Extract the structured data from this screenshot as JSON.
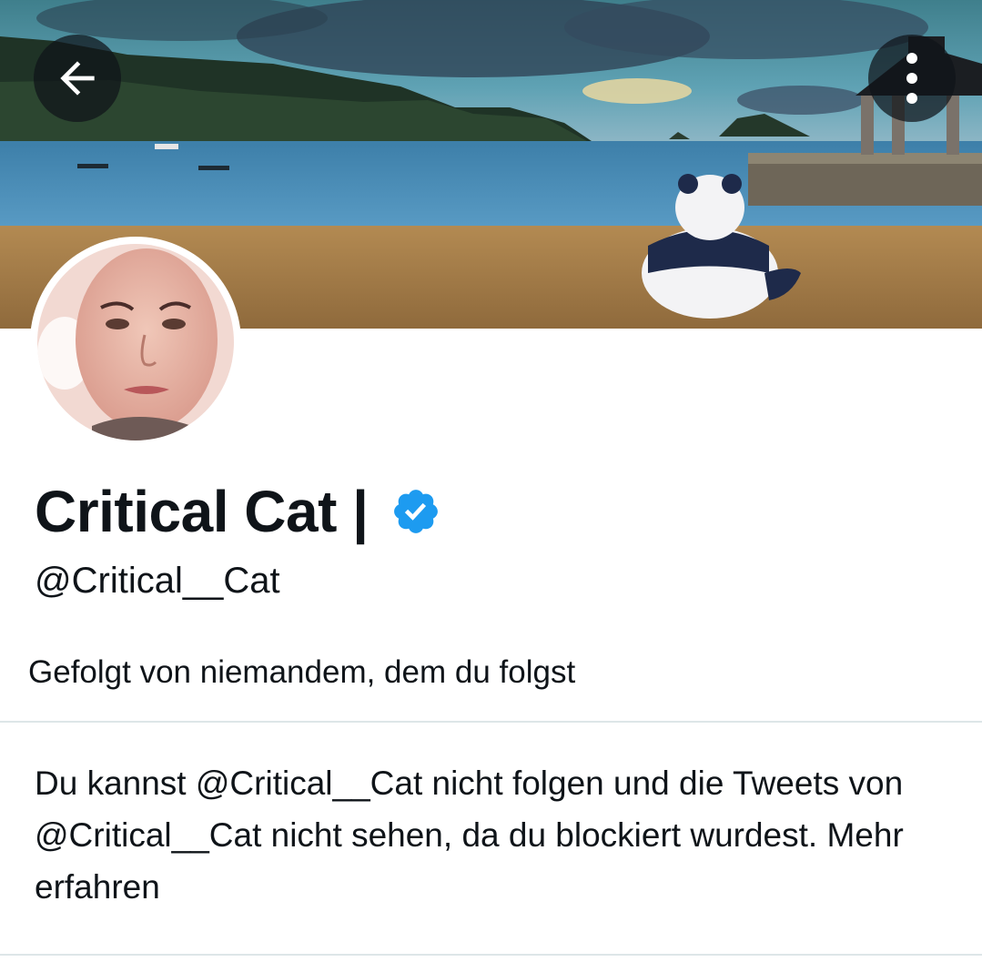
{
  "header": {
    "back_icon": "arrow-left-icon",
    "more_icon": "more-vertical-icon"
  },
  "profile": {
    "display_name": "Critical Cat |",
    "handle": "@Critical__Cat",
    "verified": true,
    "verified_color": "#1d9bf0",
    "followed_by_text": "Gefolgt von niemandem, dem du folgst"
  },
  "blocked_notice": {
    "text": "Du kannst @Critical__Cat nicht folgen und die Tweets von @Critical__Cat nicht sehen, da du blockiert wurdest.",
    "link_label": "Mehr erfahren"
  }
}
